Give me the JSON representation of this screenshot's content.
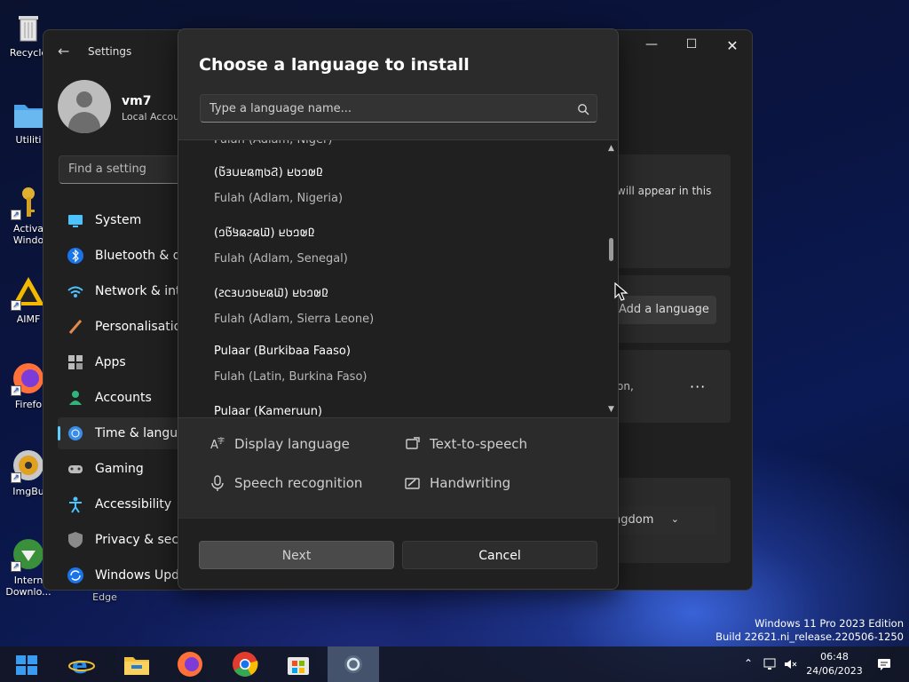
{
  "desktop": {
    "icons": [
      {
        "label": "Recycle",
        "icon": "recycle-bin-icon"
      },
      {
        "label": "Utiliti",
        "icon": "folder-icon"
      },
      {
        "label": "Activa Windo",
        "icon": "key-icon"
      },
      {
        "label": "AIMF",
        "icon": "aimp-icon"
      },
      {
        "label": "Firefo",
        "icon": "firefox-icon"
      },
      {
        "label": "ImgBu",
        "icon": "imgburn-icon"
      },
      {
        "label": "Intern Downlo...",
        "icon": "internet-download-icon"
      }
    ],
    "edge_label": "Edge"
  },
  "settings": {
    "title": "Settings",
    "user_name": "vm7",
    "user_type": "Local Accou",
    "search_placeholder": "Find a setting",
    "nav": [
      {
        "label": "System",
        "icon": "system-icon"
      },
      {
        "label": "Bluetooth & de",
        "icon": "bluetooth-icon"
      },
      {
        "label": "Network & inte",
        "icon": "network-icon"
      },
      {
        "label": "Personalisation",
        "icon": "brush-icon"
      },
      {
        "label": "Apps",
        "icon": "apps-icon"
      },
      {
        "label": "Accounts",
        "icon": "accounts-icon"
      },
      {
        "label": "Time & langua",
        "icon": "time-language-icon"
      },
      {
        "label": "Gaming",
        "icon": "gaming-icon"
      },
      {
        "label": "Accessibility",
        "icon": "accessibility-icon"
      },
      {
        "label": "Privacy & secur",
        "icon": "shield-icon"
      },
      {
        "label": "Windows Upda",
        "icon": "update-icon"
      }
    ],
    "card_text_1": "will appear in this",
    "add_language_label": "Add a language",
    "card_text_2": "on,",
    "more_label": "···",
    "region_value": "ngdom"
  },
  "dialog": {
    "title": "Choose a language to install",
    "search_placeholder": "Type a language name...",
    "partial_item": "Fulah (Adlam, Niger)",
    "languages": [
      {
        "native": "(𞤐𞤢𞤶𞤫𞤪𞤭𞤴𞤢𞥄) 𞤆𞤵𞤤𞤢𞤪",
        "english": "Fulah (Adlam, Nigeria)"
      },
      {
        "native": "(𞤅𞤫𞤲𞤫𞤺𞤢𞥄𞤤) 𞤆𞤵𞤤𞤢𞤪",
        "english": "Fulah (Adlam, Senegal)"
      },
      {
        "native": "(𞤅𞤫𞤪𞤢𞤤𞤭𞤴𞤮𞤲) 𞤆𞤵𞤤𞤢𞤪",
        "english": "Fulah (Adlam, Sierra Leone)"
      },
      {
        "native": "Pulaar (Burkibaa Faaso)",
        "english": "Fulah (Latin, Burkina Faso)"
      },
      {
        "native": "Pulaar (Kameruun)",
        "english": ""
      }
    ],
    "features": {
      "display_language": "Display language",
      "text_to_speech": "Text-to-speech",
      "speech_recognition": "Speech recognition",
      "handwriting": "Handwriting"
    },
    "next_label": "Next",
    "cancel_label": "Cancel"
  },
  "watermark": {
    "edition": "Windows 11 Pro 2023 Edition",
    "build": "Build 22621.ni_release.220506-1250"
  },
  "taskbar": {
    "time": "06:48",
    "date": "24/06/2023",
    "apps": [
      "start-icon",
      "internet-explorer-icon",
      "file-explorer-icon",
      "firefox-icon",
      "chrome-icon",
      "store-icon",
      "settings-icon"
    ]
  },
  "colors": {
    "accent": "#60cdff",
    "dialog_bg": "#2b2b2b",
    "window_bg": "#202020"
  }
}
